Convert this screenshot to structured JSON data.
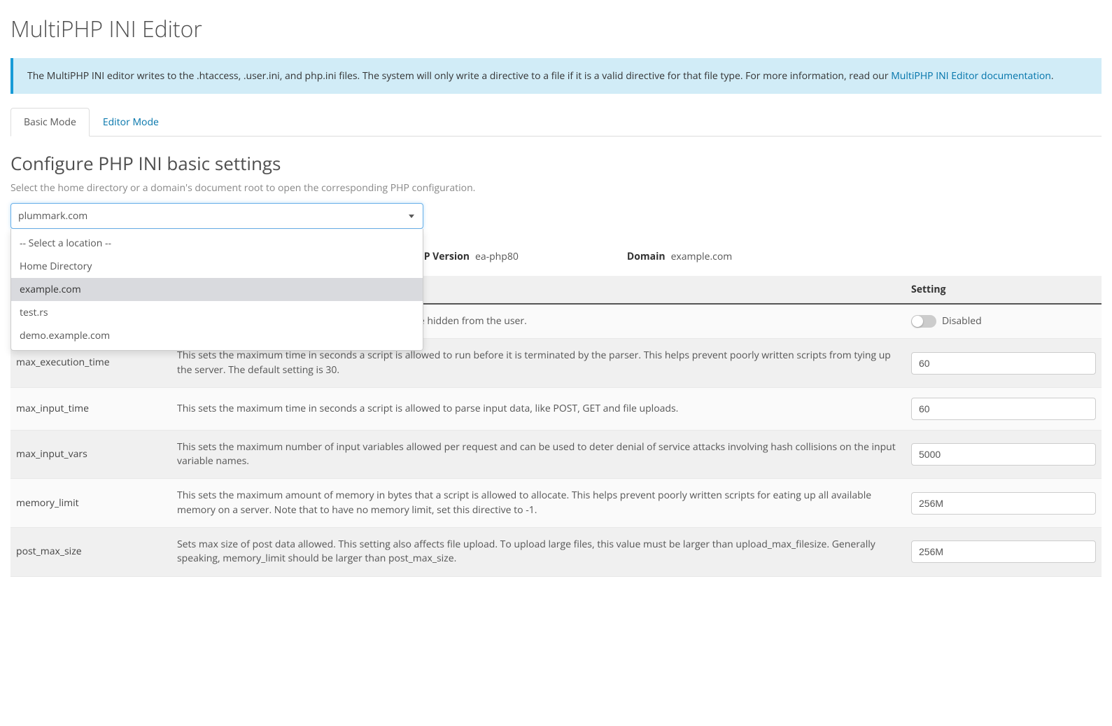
{
  "page_title": "MultiPHP INI Editor",
  "alert": {
    "text_before_link": "The MultiPHP INI editor writes to the .htaccess, .user.ini, and php.ini files. The system will only write a directive to a file if it is a valid directive for that file type. For more information, read our ",
    "link_text": "MultiPHP INI Editor documentation",
    "text_after_link": "."
  },
  "tabs": {
    "basic": "Basic Mode",
    "editor": "Editor Mode"
  },
  "section": {
    "title": "Configure PHP INI basic settings",
    "desc": "Select the home directory or a domain's document root to open the corresponding PHP configuration."
  },
  "selector": {
    "current": "plummark.com",
    "options": [
      "-- Select a location --",
      "Home Directory",
      "example.com",
      "test.rs",
      "demo.example.com"
    ],
    "highlighted_index": 2
  },
  "meta": {
    "php_version_label": "HP Version",
    "php_version_value": "ea-php80",
    "domain_label": "Domain",
    "domain_value": "example.com"
  },
  "table": {
    "headers": {
      "setting": "Setting"
    },
    "rows": [
      {
        "directive": "",
        "info": "to the screen as part of the output or if they should be hidden from the user.",
        "type": "toggle",
        "value_label": "Disabled"
      },
      {
        "directive": "max_execution_time",
        "info": "This sets the maximum time in seconds a script is allowed to run before it is terminated by the parser. This helps prevent poorly written scripts from tying up the server. The default setting is 30.",
        "type": "text",
        "value": "60"
      },
      {
        "directive": "max_input_time",
        "info": "This sets the maximum time in seconds a script is allowed to parse input data, like POST, GET and file uploads.",
        "type": "text",
        "value": "60"
      },
      {
        "directive": "max_input_vars",
        "info": "This sets the maximum number of input variables allowed per request and can be used to deter denial of service attacks involving hash collisions on the input variable names.",
        "type": "text",
        "value": "5000"
      },
      {
        "directive": "memory_limit",
        "info": "This sets the maximum amount of memory in bytes that a script is allowed to allocate. This helps prevent poorly written scripts for eating up all available memory on a server. Note that to have no memory limit, set this directive to -1.",
        "type": "text",
        "value": "256M"
      },
      {
        "directive": "post_max_size",
        "info": "Sets max size of post data allowed. This setting also affects file upload. To upload large files, this value must be larger than upload_max_filesize. Generally speaking, memory_limit should be larger than post_max_size.",
        "type": "text",
        "value": "256M"
      }
    ]
  }
}
